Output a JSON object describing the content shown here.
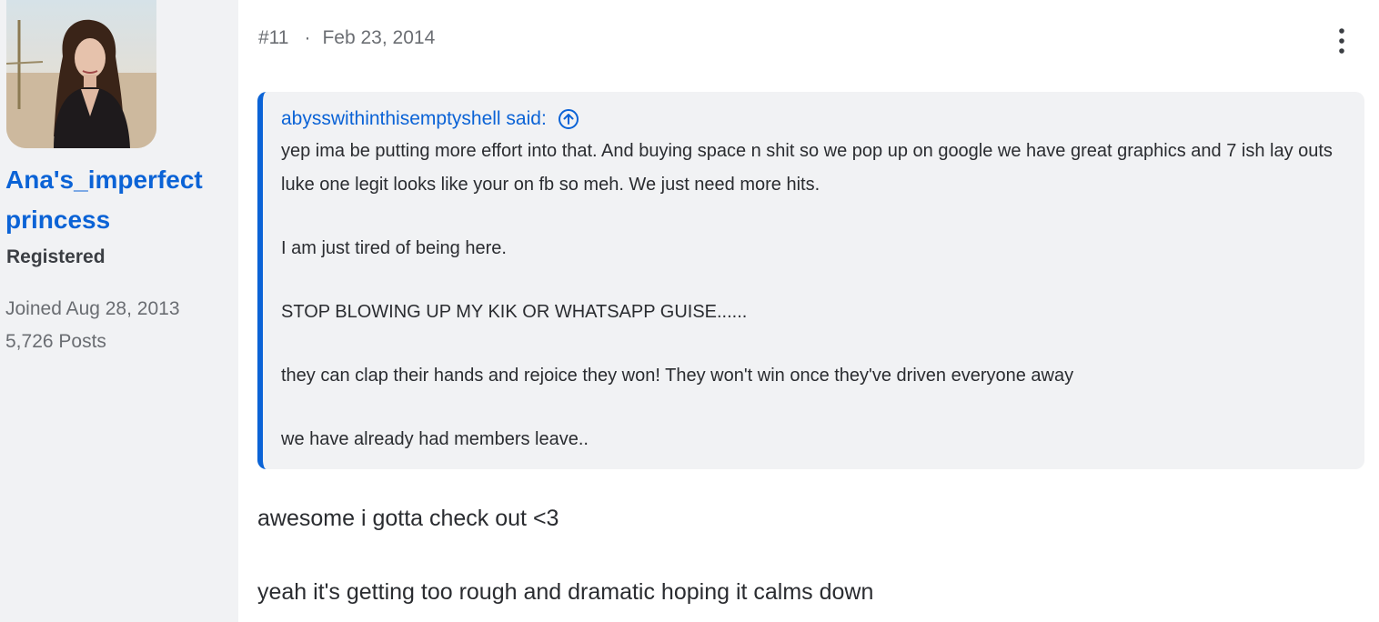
{
  "user": {
    "name": "Ana's_imperfect princess",
    "title": "Registered",
    "joined": "Joined Aug 28, 2013",
    "posts": "5,726 Posts"
  },
  "post": {
    "number": "#11",
    "separator": "·",
    "date": "Feb 23, 2014",
    "menu_icon": "vertical-ellipsis-icon"
  },
  "quote": {
    "author_line": "abysswithinthisemptyshell said:",
    "jump_icon": "arrow-up-circle-icon",
    "paragraphs": [
      "yep ima be putting more effort into that. And buying space n shit so we pop up on google we have great graphics and 7 ish lay outs luke one legit looks like your on fb so meh. We just need more hits.",
      "I am just tired of being here.",
      "STOP BLOWING UP MY KIK OR WHATSAPP GUISE......",
      "they can clap their hands and rejoice they won! They won't win once they've driven everyone away",
      "we have already had members leave.."
    ]
  },
  "reply": {
    "lines": [
      "awesome i gotta check out <3",
      "yeah it's getting too rough and dramatic hoping it calms down"
    ]
  },
  "colors": {
    "accent": "#0b63d6",
    "sidebar_bg": "#f1f2f4",
    "quote_bg": "#f1f2f4",
    "muted_text": "#6b6e73"
  }
}
